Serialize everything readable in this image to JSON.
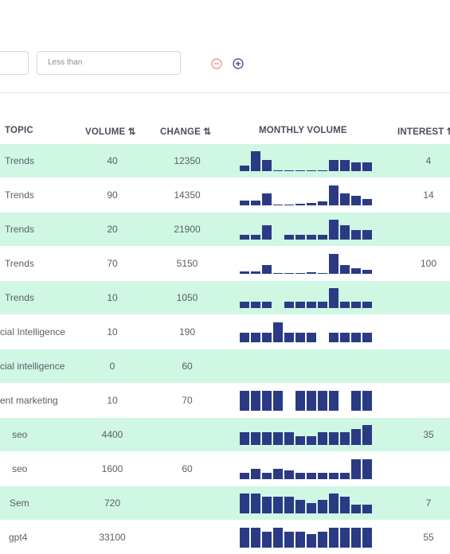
{
  "filters": {
    "first_input_value": "",
    "less_than_placeholder": "Less than",
    "remove_icon": "minus-circle",
    "add_icon": "plus-circle",
    "remove_color": "#f08080",
    "add_color": "#2b3a85"
  },
  "table": {
    "headers": {
      "topic": "TOPIC",
      "volume": "VOLUME ⇅",
      "change": "CHANGE ⇅",
      "monthly": "MONTHLY VOLUME",
      "interest": "INTEREST ⇅"
    },
    "bar_color": "#2b3a85",
    "alt_row_color": "#cff7e3",
    "rows": [
      {
        "topic": "Trends",
        "volume": "40",
        "change": "12350",
        "interest": "4",
        "monthly": [
          30,
          100,
          55,
          5,
          5,
          5,
          5,
          5,
          55,
          55,
          45,
          45
        ]
      },
      {
        "topic": "Trends",
        "volume": "90",
        "change": "14350",
        "interest": "14",
        "monthly": [
          24,
          24,
          60,
          4,
          4,
          8,
          12,
          20,
          100,
          60,
          48,
          32
        ]
      },
      {
        "topic": "Trends",
        "volume": "20",
        "change": "21900",
        "interest": "",
        "monthly": [
          24,
          24,
          74,
          0,
          24,
          24,
          24,
          24,
          100,
          74,
          50,
          50
        ]
      },
      {
        "topic": "Trends",
        "volume": "70",
        "change": "5150",
        "interest": "100",
        "monthly": [
          14,
          14,
          45,
          3,
          5,
          5,
          8,
          5,
          100,
          45,
          27,
          22
        ]
      },
      {
        "topic": "Trends",
        "volume": "10",
        "change": "1050",
        "interest": "",
        "monthly": [
          33,
          33,
          33,
          0,
          33,
          33,
          33,
          33,
          100,
          33,
          33,
          33
        ]
      },
      {
        "topic": "cial Intelligence",
        "volume": "10",
        "change": "190",
        "interest": "",
        "monthly": [
          50,
          50,
          50,
          100,
          50,
          50,
          50,
          0,
          50,
          50,
          50,
          50
        ]
      },
      {
        "topic": "cial intelligence",
        "volume": "0",
        "change": "60",
        "interest": "",
        "monthly": []
      },
      {
        "topic": "ent marketing",
        "volume": "10",
        "change": "70",
        "interest": "",
        "monthly": [
          100,
          100,
          100,
          100,
          0,
          100,
          100,
          100,
          100,
          0,
          100,
          100
        ]
      },
      {
        "topic": "seo",
        "volume": "4400",
        "change": "",
        "interest": "35",
        "monthly": [
          65,
          65,
          65,
          65,
          65,
          43,
          43,
          65,
          65,
          65,
          81,
          100
        ]
      },
      {
        "topic": "seo",
        "volume": "1600",
        "change": "60",
        "interest": "",
        "monthly": [
          32,
          54,
          32,
          54,
          43,
          32,
          32,
          32,
          32,
          32,
          100,
          100
        ]
      },
      {
        "topic": "Sem",
        "volume": "720",
        "change": "",
        "interest": "7",
        "monthly": [
          100,
          100,
          84,
          84,
          84,
          68,
          54,
          68,
          100,
          84,
          43,
          43
        ]
      },
      {
        "topic": "gpt4",
        "volume": "33100",
        "change": "",
        "interest": "55",
        "monthly": [
          100,
          100,
          81,
          100,
          81,
          81,
          68,
          81,
          100,
          100,
          100,
          100
        ]
      }
    ]
  }
}
